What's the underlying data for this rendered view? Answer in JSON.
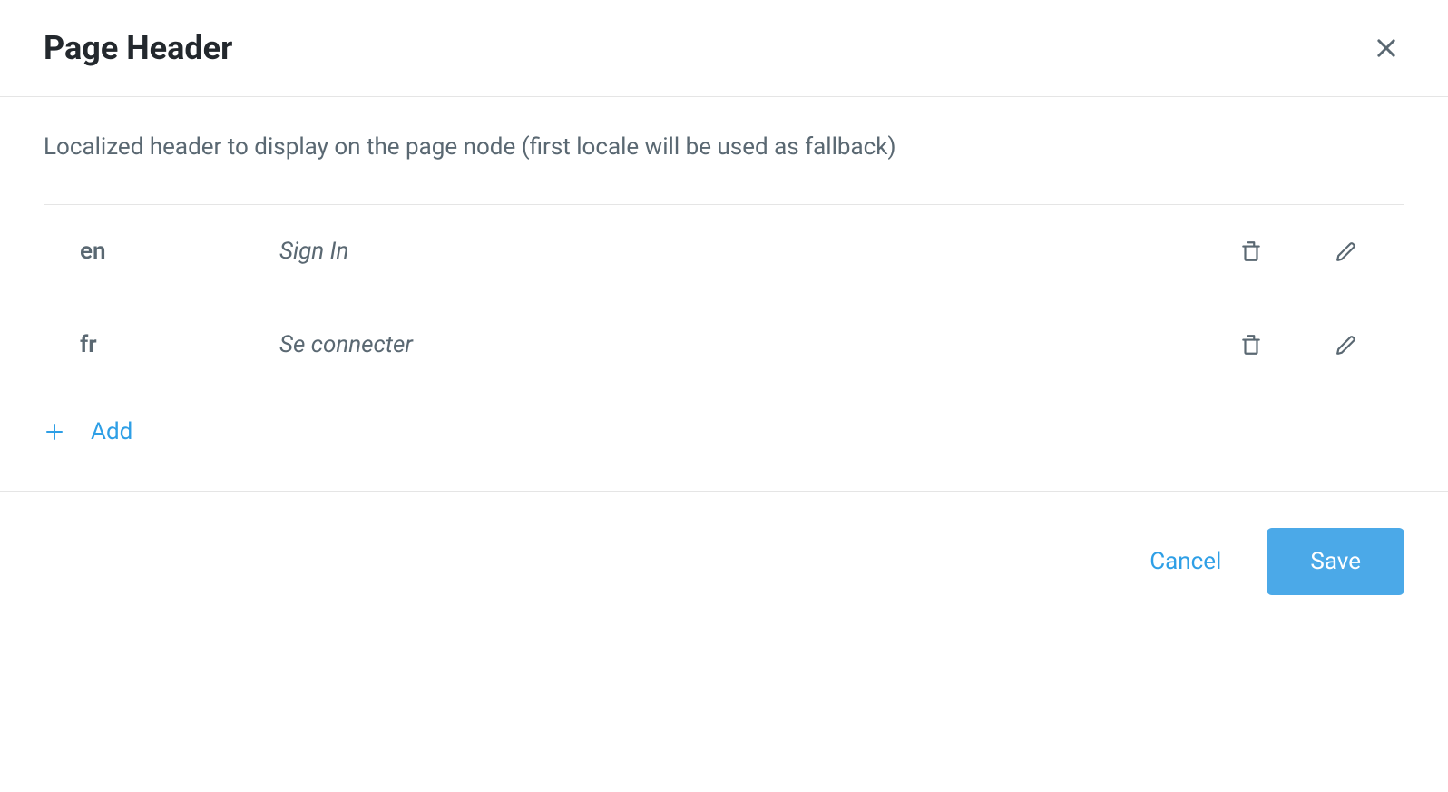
{
  "header": {
    "title": "Page Header"
  },
  "body": {
    "description": "Localized header to display on the page node (first locale will be used as fallback)",
    "locales": [
      {
        "code": "en",
        "value": "Sign In"
      },
      {
        "code": "fr",
        "value": "Se connecter"
      }
    ],
    "add_label": "Add"
  },
  "footer": {
    "cancel_label": "Cancel",
    "save_label": "Save"
  }
}
